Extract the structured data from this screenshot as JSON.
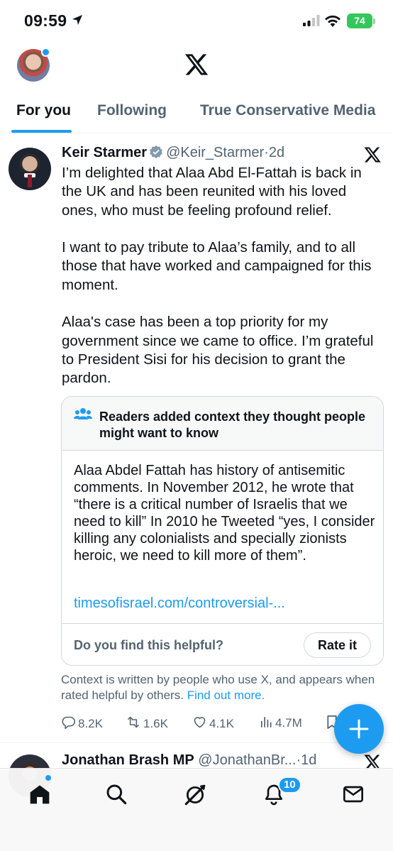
{
  "status_bar": {
    "time": "09:59",
    "battery": "74",
    "icons": [
      "location-arrow-icon",
      "cell-signal-icon",
      "wifi-icon",
      "battery-charging-icon"
    ]
  },
  "header": {
    "logo": "X"
  },
  "tabs": [
    {
      "label": "For you",
      "active": true
    },
    {
      "label": "Following",
      "active": false
    },
    {
      "label": "True Conservative Media",
      "active": false
    }
  ],
  "tweet": {
    "name": "Keir Starmer",
    "handle": "@Keir_Starmer",
    "separator": "·",
    "time": "2d",
    "verified": true,
    "paragraphs": [
      "I’m delighted that Alaa Abd El-Fattah is back in the UK and has been reunited with his loved ones, who must be feeling profound relief.",
      "I want to pay tribute to Alaa’s family, and to all those that have worked and campaigned for this moment.",
      "Alaa's case has been a top priority for my government since we came to office. I’m grateful to President Sisi for his decision to grant the pardon."
    ],
    "community_note": {
      "title": "Readers added context they thought people might want to know",
      "body": "Alaa Abdel Fattah has history of antisemitic comments. In November 2012, he wrote that “there is a critical number of Israelis that we need to kill” In 2010 he Tweeted “yes, I consider killing any colonialists and specially zionists heroic, we need to kill more of them”.",
      "link": "timesofisrael.com/controversial-...",
      "question": "Do you find this helpful?",
      "rate_button": "Rate it"
    },
    "context_text": "Context is written by people who use X, and appears when rated helpful by others.",
    "context_link": "Find out more.",
    "actions": {
      "replies": "8.2K",
      "reposts": "1.6K",
      "likes": "4.1K",
      "views": "4.7M"
    }
  },
  "next_tweet": {
    "name": "Jonathan Brash MP",
    "handle": "@JonathanBr...",
    "separator": "·",
    "time": "1d"
  },
  "bottom_nav": {
    "items": [
      "home-icon",
      "search-icon",
      "grok-icon",
      "notifications-icon",
      "messages-icon"
    ],
    "notification_badge": "10"
  },
  "colors": {
    "accent": "#1d9bf0",
    "text": "#0f1419",
    "secondary": "#536471",
    "battery": "#34c759"
  }
}
